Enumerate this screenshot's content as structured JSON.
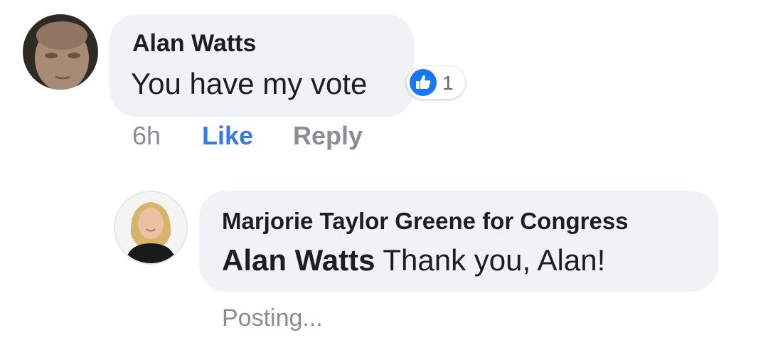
{
  "colors": {
    "bubble_bg": "#f0f2f5",
    "text": "#1c1e21",
    "muted": "#8a8d91",
    "like_blue": "#1877f2",
    "like_action": "#3b78e7"
  },
  "comment": {
    "author": "Alan Watts",
    "text": "You have my vote",
    "reaction": {
      "icon": "thumbs-up-icon",
      "count": "1"
    },
    "actions": {
      "time": "6h",
      "like": "Like",
      "reply": "Reply"
    }
  },
  "reply": {
    "author": "Marjorie Taylor Greene for Congress",
    "mention": "Alan Watts",
    "text": "Thank you, Alan!",
    "status": "Posting..."
  }
}
